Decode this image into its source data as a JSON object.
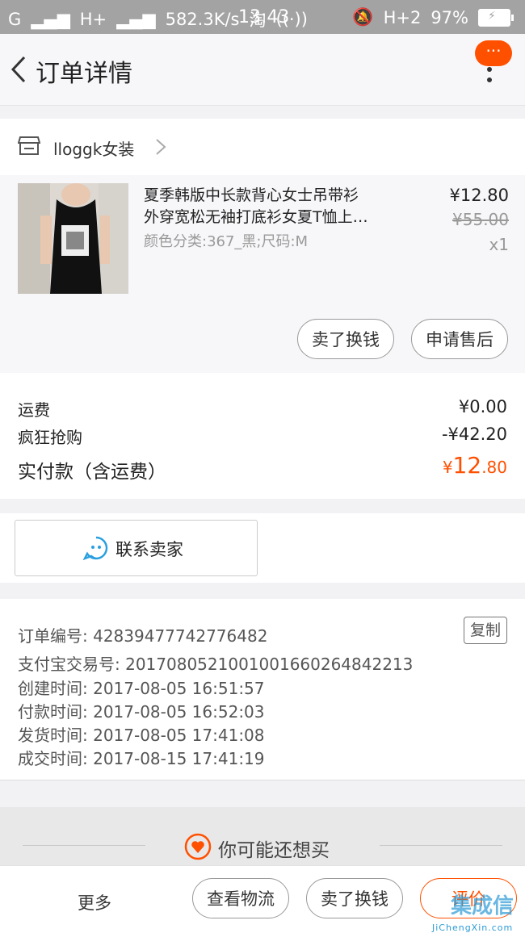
{
  "status_bar": {
    "signal_left": "G",
    "signal_right": "H+",
    "speed": "582.3K/s",
    "app_glyph": "淘",
    "time": "13:43",
    "network": "H+2",
    "battery": "97%"
  },
  "header": {
    "title": "订单详情",
    "more_badge": "···"
  },
  "shop": {
    "name": "lloggk女装"
  },
  "product": {
    "title_line1": "夏季韩版中长款背心女士吊带衫",
    "title_line2": "外穿宽松无袖打底衫女夏T恤上…",
    "sku": "颜色分类:367_黑;尺码:M",
    "price_now": "¥12.80",
    "price_old": "¥55.00",
    "qty": "x1",
    "btn_refund": "卖了换钱",
    "btn_aftersale": "申请售后"
  },
  "cost": {
    "shipping_label": "运费",
    "shipping_value": "¥0.00",
    "discount_label": "疯狂抢购",
    "discount_value": "-¥42.20",
    "total_label": "实付款（含运费）",
    "total_currency": "¥",
    "total_int": "12",
    "total_dec": ".80"
  },
  "contact": {
    "label": "联系卖家"
  },
  "order_info": {
    "order_no": "订单编号: 42839477742776482",
    "alipay_no": "支付宝交易号: 2017080521001001660264842213",
    "created": "创建时间: 2017-08-05 16:51:57",
    "paid": "付款时间: 2017-08-05 16:52:03",
    "shipped": "发货时间: 2017-08-05 17:41:08",
    "completed": "成交时间: 2017-08-15 17:41:19",
    "copy_label": "复制"
  },
  "recommend": {
    "label": "你可能还想买"
  },
  "bottom": {
    "more": "更多",
    "logistics": "查看物流",
    "refund": "卖了换钱",
    "review": "评价"
  },
  "watermark": {
    "chars": "集成信",
    "text": "JiChengXin.com"
  },
  "colors": {
    "accent": "#ff5000",
    "contact_blue": "#2a9fe0"
  }
}
